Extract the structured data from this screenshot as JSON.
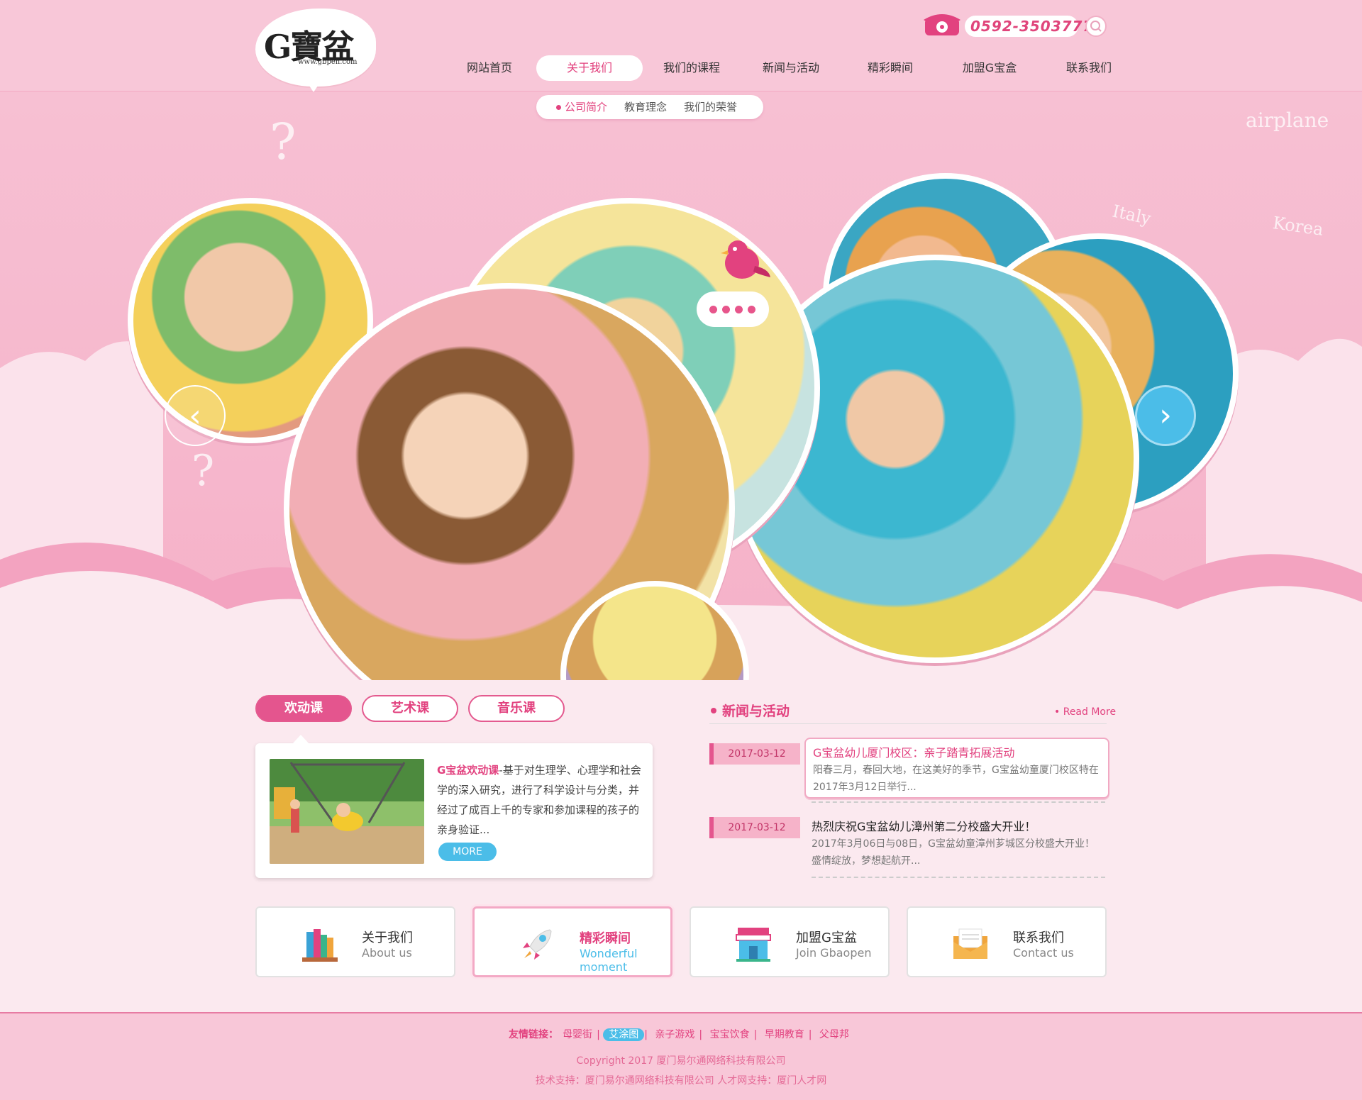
{
  "header": {
    "logo_text": "G寶盆",
    "logo_url": "www.gbpen.com",
    "phone": "0592-3503777"
  },
  "nav": {
    "items": [
      "网站首页",
      "关于我们",
      "我们的课程",
      "新闻与活动",
      "精彩瞬间",
      "加盟G宝盒",
      "联系我们"
    ],
    "active_index": 1
  },
  "subnav": {
    "items": [
      "公司简介",
      "教育理念",
      "我们的荣誉"
    ],
    "active_index": 0
  },
  "hero": {
    "doodle_words": [
      "airplane",
      "Italy",
      "Korea"
    ],
    "slides_count": 4
  },
  "courses": {
    "tabs": [
      "欢动课",
      "艺术课",
      "音乐课"
    ],
    "active_tab": 0,
    "card": {
      "title": "G宝盆欢动课",
      "text": "-基于对生理学、心理学和社会学的深入研究，进行了科学设计与分类，并经过了成百上千的专家和参加课程的孩子的亲身验证...",
      "more_label": "MORE"
    }
  },
  "news": {
    "section_title": "新闻与活动",
    "read_more": "Read More",
    "items": [
      {
        "date": "2017-03-12",
        "headline": "G宝盆幼儿厦门校区：亲子踏青拓展活动",
        "summary": "阳春三月，春回大地，在这美好的季节，G宝盆幼童厦门校区特在2017年3月12日举行..."
      },
      {
        "date": "2017-03-12",
        "headline": "热烈庆祝G宝盆幼儿漳州第二分校盛大开业！",
        "summary": "2017年3月06日与08日，G宝盆幼童漳州芗城区分校盛大开业！盛情绽放，梦想起航开..."
      }
    ]
  },
  "features": [
    {
      "title": "关于我们",
      "subtitle": "About us",
      "icon": "books-icon"
    },
    {
      "title": "精彩瞬间",
      "subtitle": "Wonderful moment",
      "icon": "rocket-icon"
    },
    {
      "title": "加盟G宝盆",
      "subtitle": "Join Gbaopen",
      "icon": "shop-icon"
    },
    {
      "title": "联系我们",
      "subtitle": "Contact us",
      "icon": "envelope-icon"
    }
  ],
  "footer": {
    "links_label": "友情链接：",
    "links": [
      "母婴街",
      "艾涂图",
      "亲子游戏",
      "宝宝饮食",
      "早期教育",
      "父母邦"
    ],
    "active_link": 1,
    "copyright": "Copyright 2017 厦门易尔通网络科技有限公司",
    "support": "技术支持：厦门易尔通网络科技有限公司  人才网支持：厦门人才网"
  },
  "colors": {
    "pink_primary": "#e2427f",
    "pink_bg": "#f8c7d8",
    "blue_accent": "#4bbde8"
  }
}
